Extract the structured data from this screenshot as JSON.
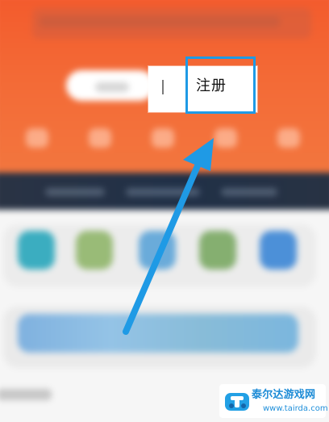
{
  "register": {
    "label": "注册"
  },
  "watermark": {
    "title": "泰尔达游戏网",
    "url": "www.tairda.com"
  },
  "colors": {
    "header": "#f36a36",
    "highlight": "#1f9ae5",
    "arrow": "#1f9ae5",
    "background": "#f6f6f6"
  },
  "icons": {
    "arrow": "arrow-icon",
    "watermark_logo": "tairda-logo-icon"
  }
}
